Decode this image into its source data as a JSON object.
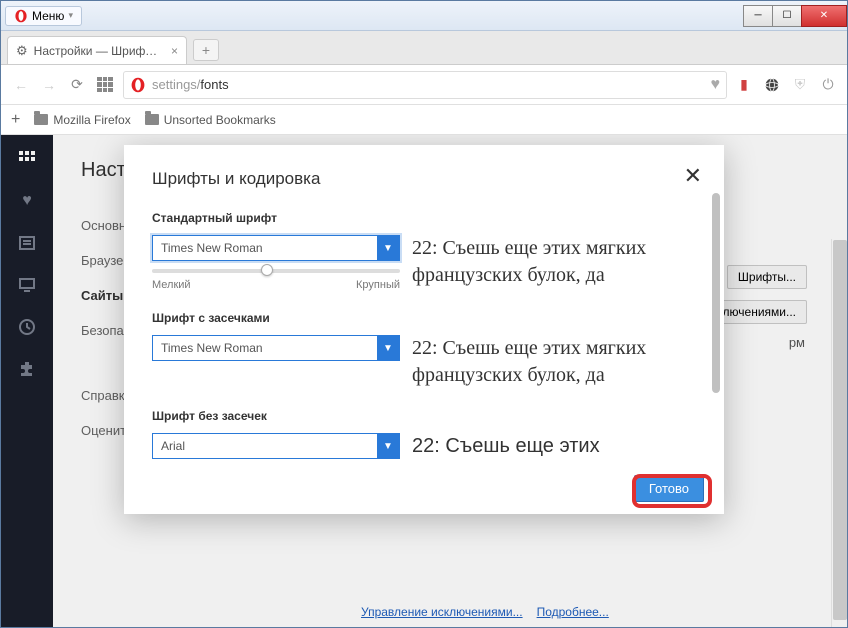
{
  "window": {
    "menu_label": "Меню"
  },
  "tab": {
    "title": "Настройки — Шрифты и..."
  },
  "url": {
    "prefix": "settings/",
    "path": "fonts"
  },
  "bookmarks": {
    "add_tooltip": "+",
    "items": [
      "Mozilla Firefox",
      "Unsorted Bookmarks"
    ]
  },
  "settings": {
    "heading": "Настройки",
    "nav": [
      "Основные",
      "Браузер",
      "Сайты",
      "Безопасность"
    ],
    "help": "Справка",
    "rate": "Оценить",
    "side_button_1": "Шрифты...",
    "side_button_2": "Управление исключениями...",
    "bg_text": "рм",
    "footer_1": "Управление исключениями...",
    "footer_2": "Подробнее..."
  },
  "modal": {
    "title": "Шрифты и кодировка",
    "sections": {
      "standard": {
        "label": "Стандартный шрифт",
        "value": "Times New Roman",
        "preview": "22: Съешь еще этих мягких французских булок, да",
        "slider_min": "Мелкий",
        "slider_max": "Крупный"
      },
      "serif": {
        "label": "Шрифт с засечками",
        "value": "Times New Roman",
        "preview": "22: Съешь еще этих мягких французских булок, да"
      },
      "sans": {
        "label": "Шрифт без засечек",
        "value": "Arial",
        "preview": "22: Съешь еще этих"
      }
    },
    "done": "Готово"
  }
}
